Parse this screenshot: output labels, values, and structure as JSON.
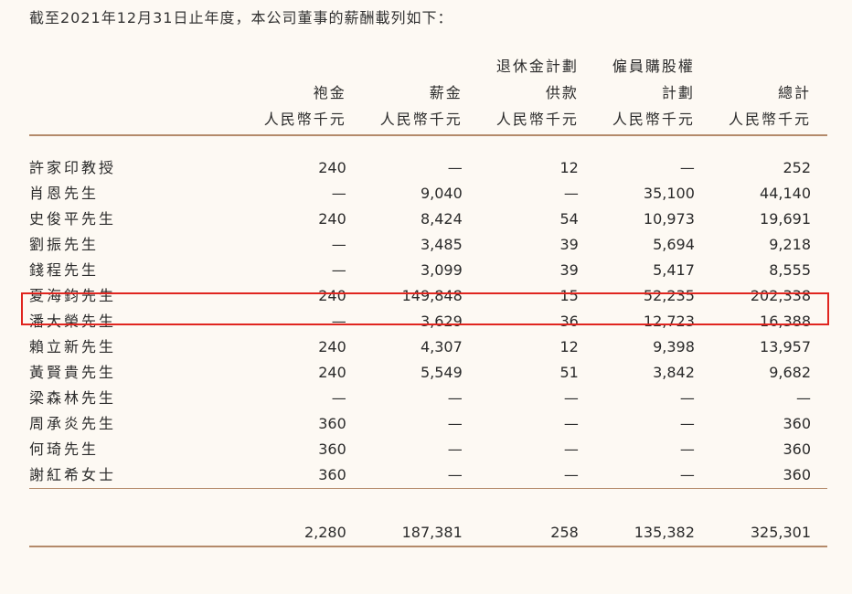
{
  "intro": "截至2021年12月31日止年度，本公司董事的薪酬載列如下：",
  "headers": {
    "row1": [
      "",
      "",
      "",
      "退休金計劃",
      "僱員購股權",
      ""
    ],
    "row2": [
      "",
      "袍金",
      "薪金",
      "供款",
      "計劃",
      "總計"
    ],
    "row3": [
      "",
      "人民幣千元",
      "人民幣千元",
      "人民幣千元",
      "人民幣千元",
      "人民幣千元"
    ]
  },
  "rows": [
    {
      "name": "許家印教授",
      "fees": "240",
      "salary": "—",
      "pension": "12",
      "options": "—",
      "total": "252"
    },
    {
      "name": "肖恩先生",
      "fees": "—",
      "salary": "9,040",
      "pension": "—",
      "options": "35,100",
      "total": "44,140"
    },
    {
      "name": "史俊平先生",
      "fees": "240",
      "salary": "8,424",
      "pension": "54",
      "options": "10,973",
      "total": "19,691"
    },
    {
      "name": "劉振先生",
      "fees": "—",
      "salary": "3,485",
      "pension": "39",
      "options": "5,694",
      "total": "9,218"
    },
    {
      "name": "錢程先生",
      "fees": "—",
      "salary": "3,099",
      "pension": "39",
      "options": "5,417",
      "total": "8,555"
    },
    {
      "name": "夏海鈞先生",
      "fees": "240",
      "salary": "149,848",
      "pension": "15",
      "options": "52,235",
      "total": "202,338"
    },
    {
      "name": "潘大榮先生",
      "fees": "—",
      "salary": "3,629",
      "pension": "36",
      "options": "12,723",
      "total": "16,388"
    },
    {
      "name": "賴立新先生",
      "fees": "240",
      "salary": "4,307",
      "pension": "12",
      "options": "9,398",
      "total": "13,957"
    },
    {
      "name": "黃賢貴先生",
      "fees": "240",
      "salary": "5,549",
      "pension": "51",
      "options": "3,842",
      "total": "9,682"
    },
    {
      "name": "梁森林先生",
      "fees": "—",
      "salary": "—",
      "pension": "—",
      "options": "—",
      "total": "—"
    },
    {
      "name": "周承炎先生",
      "fees": "360",
      "salary": "—",
      "pension": "—",
      "options": "—",
      "total": "360"
    },
    {
      "name": "何琦先生",
      "fees": "360",
      "salary": "—",
      "pension": "—",
      "options": "—",
      "total": "360"
    },
    {
      "name": "謝紅希女士",
      "fees": "360",
      "salary": "—",
      "pension": "—",
      "options": "—",
      "total": "360"
    }
  ],
  "totals": {
    "fees": "2,280",
    "salary": "187,381",
    "pension": "258",
    "options": "135,382",
    "total": "325,301"
  },
  "highlight_color": "#e0251f",
  "rule_color": "#b48a6a"
}
